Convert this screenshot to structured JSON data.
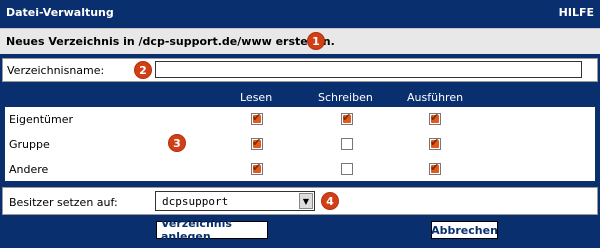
{
  "titlebar": {
    "app_title": "Datei-Verwaltung",
    "help_label": "HILFE"
  },
  "info": {
    "message": "Neues Verzeichnis in /dcp-support.de/www erstellen."
  },
  "badges": [
    "1",
    "2",
    "3",
    "4"
  ],
  "form": {
    "directory_name_label": "Verzeichnisname:",
    "directory_name_value": "",
    "owner_label": "Besitzer setzen auf:",
    "owner_selected": "dcpsupport"
  },
  "permissions": {
    "columns": [
      "Lesen",
      "Schreiben",
      "Ausführen"
    ],
    "rows": [
      {
        "label": "Eigentümer",
        "read": true,
        "write": true,
        "execute": true
      },
      {
        "label": "Gruppe",
        "read": true,
        "write": false,
        "execute": true
      },
      {
        "label": "Andere",
        "read": true,
        "write": false,
        "execute": true
      }
    ]
  },
  "buttons": {
    "create_label": "Verzeichnis anlegen",
    "cancel_label": "Abbrechen"
  },
  "colors": {
    "header_blue": "#0a2f6e",
    "badge_red": "#d13f17",
    "checkbox_orange": "#e05a1d"
  }
}
